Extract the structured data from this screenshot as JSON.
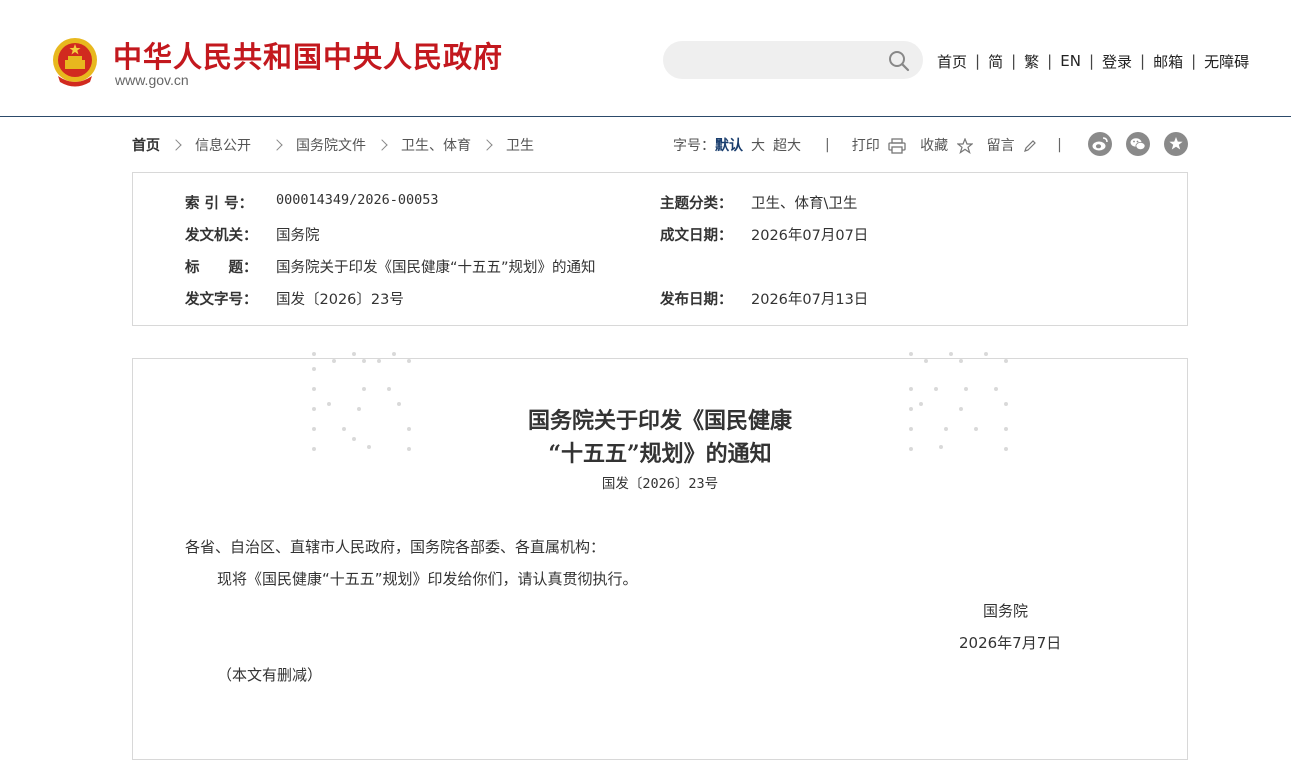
{
  "header": {
    "site_name": "中华人民共和国中央人民政府",
    "site_url": "www.gov.cn",
    "search_placeholder": "",
    "nav": [
      "首页",
      "简",
      "繁",
      "EN",
      "登录",
      "邮箱",
      "无障碍"
    ]
  },
  "breadcrumb": [
    "首页",
    "信息公开",
    "国务院文件",
    "卫生、体育",
    "卫生"
  ],
  "tools": {
    "font_size_label": "字号：",
    "font_default": "默认",
    "font_large": "大",
    "font_xlarge": "超大",
    "print": "打印",
    "favorite": "收藏",
    "message": "留言"
  },
  "share_icons": [
    "weibo-icon",
    "wechat-icon",
    "favorite-star-icon"
  ],
  "meta": {
    "index_no_label": "索 引 号：",
    "index_no": "000014349/2026-00053",
    "topic_label": "主题分类：",
    "topic": "卫生、体育\\卫生",
    "issuer_label": "发文机关：",
    "issuer": "国务院",
    "written_date_label": "成文日期：",
    "written_date": "2026年07月07日",
    "title_label": "标　　题：",
    "title": "国务院关于印发《国民健康“十五五”规划》的通知",
    "doc_no_label": "发文字号：",
    "doc_no": "国发〔2026〕23号",
    "publish_date_label": "发布日期：",
    "publish_date": "2026年07月13日"
  },
  "document": {
    "title_line1": "国务院关于印发《国民健康",
    "title_line2": "“十五五”规划》的通知",
    "doc_no": "国发〔2026〕23号",
    "salutation": "各省、自治区、直辖市人民政府，国务院各部委、各直属机构：",
    "body": "现将《国民健康“十五五”规划》印发给你们，请认真贯彻执行。",
    "signature": "国务院",
    "date": "2026年7月7日",
    "note": "（本文有删减）"
  },
  "colors": {
    "brand_red": "#c3181e",
    "accent_blue": "#1a3e6e",
    "divider": "#2c4a6a"
  }
}
